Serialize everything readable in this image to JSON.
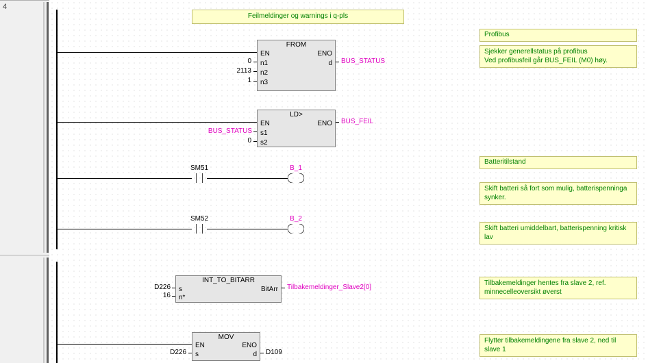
{
  "rung_number": "4",
  "title_comment": "Feilmeldinger og warnings i q-pls",
  "comments": {
    "profibus_header": "Profibus",
    "profibus_body": "Sjekker generellstatus på profibus\nVed profibusfeil går BUS_FEIL (M0) høy.",
    "battery_header": "Batteritilstand",
    "battery1": "Skift batteri så fort som mulig, batterispenninga synker.",
    "battery2": "Skift batteri umiddelbart, batterispenning kritisk lav",
    "slave2": "Tilbakemeldinger hentes fra slave 2, ref. minnecelleoversikt øverst",
    "mov": "Flytter tilbakemeldingene fra slave 2, ned til slave 1"
  },
  "from_block": {
    "title": "FROM",
    "en": "EN",
    "eno": "ENO",
    "n1": "n1",
    "n2": "n2",
    "n3": "n3",
    "d": "d",
    "in_n1": "0",
    "in_n2": "2113",
    "in_n3": "1",
    "out_d": "BUS_STATUS"
  },
  "ld_block": {
    "title": "LD>",
    "en": "EN",
    "eno": "ENO",
    "s1": "s1",
    "s2": "s2",
    "in_s1": "BUS_STATUS",
    "in_s2": "0",
    "out_eno": "BUS_FEIL"
  },
  "contact1": {
    "name": "SM51",
    "coil": "B_1"
  },
  "contact2": {
    "name": "SM52",
    "coil": "B_2"
  },
  "int_block": {
    "title": "INT_TO_BITARR",
    "s": "s",
    "nstar": "n*",
    "bitarr": "BitArr",
    "in_s": "D226",
    "in_n": "16",
    "out": "Tilbakemeldinger_Slave2[0]"
  },
  "mov_block": {
    "title": "MOV",
    "en": "EN",
    "eno": "ENO",
    "s": "s",
    "d": "d",
    "in_s": "D226",
    "out_d": "D109"
  }
}
